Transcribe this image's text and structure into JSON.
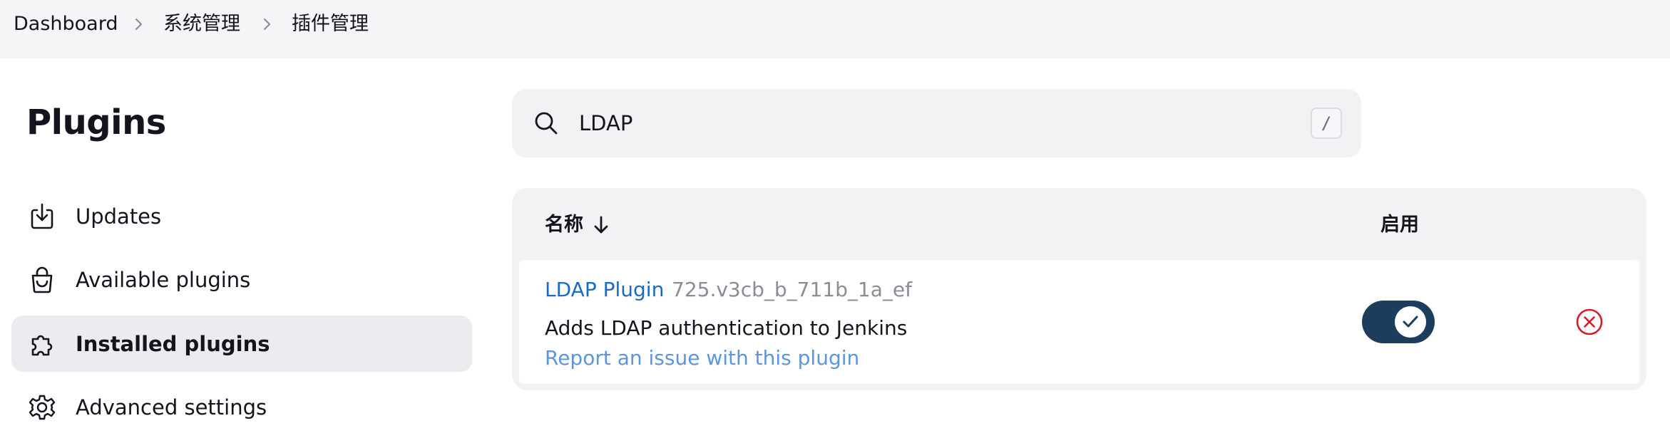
{
  "breadcrumb": {
    "items": [
      "Dashboard",
      "系统管理",
      "插件管理"
    ]
  },
  "page": {
    "title": "Plugins"
  },
  "sidebar": {
    "items": [
      {
        "label": "Updates",
        "icon": "download-icon",
        "active": false
      },
      {
        "label": "Available plugins",
        "icon": "shopping-bag-icon",
        "active": false
      },
      {
        "label": "Installed plugins",
        "icon": "puzzle-piece-icon",
        "active": true
      },
      {
        "label": "Advanced settings",
        "icon": "gear-icon",
        "active": false
      }
    ]
  },
  "search": {
    "value": "LDAP",
    "shortcut": "/",
    "icon": "search-icon"
  },
  "table": {
    "columns": {
      "name": "名称",
      "enabled": "启用"
    },
    "sort": {
      "column": "name",
      "direction": "descending",
      "icon": "arrow-down-icon"
    },
    "rows": [
      {
        "name": "LDAP Plugin",
        "version": "725.v3cb_b_711b_1a_ef",
        "description": "Adds LDAP authentication to Jenkins",
        "issue_link": "Report an issue with this plugin",
        "enabled": true,
        "uninstall_icon": "uninstall-x-circle-icon"
      }
    ]
  },
  "colors": {
    "link": "#1b6ac9",
    "issue_link": "#5b95de",
    "toggle_on": "#1d3d5c",
    "uninstall": "#d11f2b",
    "active_nav_bg": "#ebebf0"
  }
}
